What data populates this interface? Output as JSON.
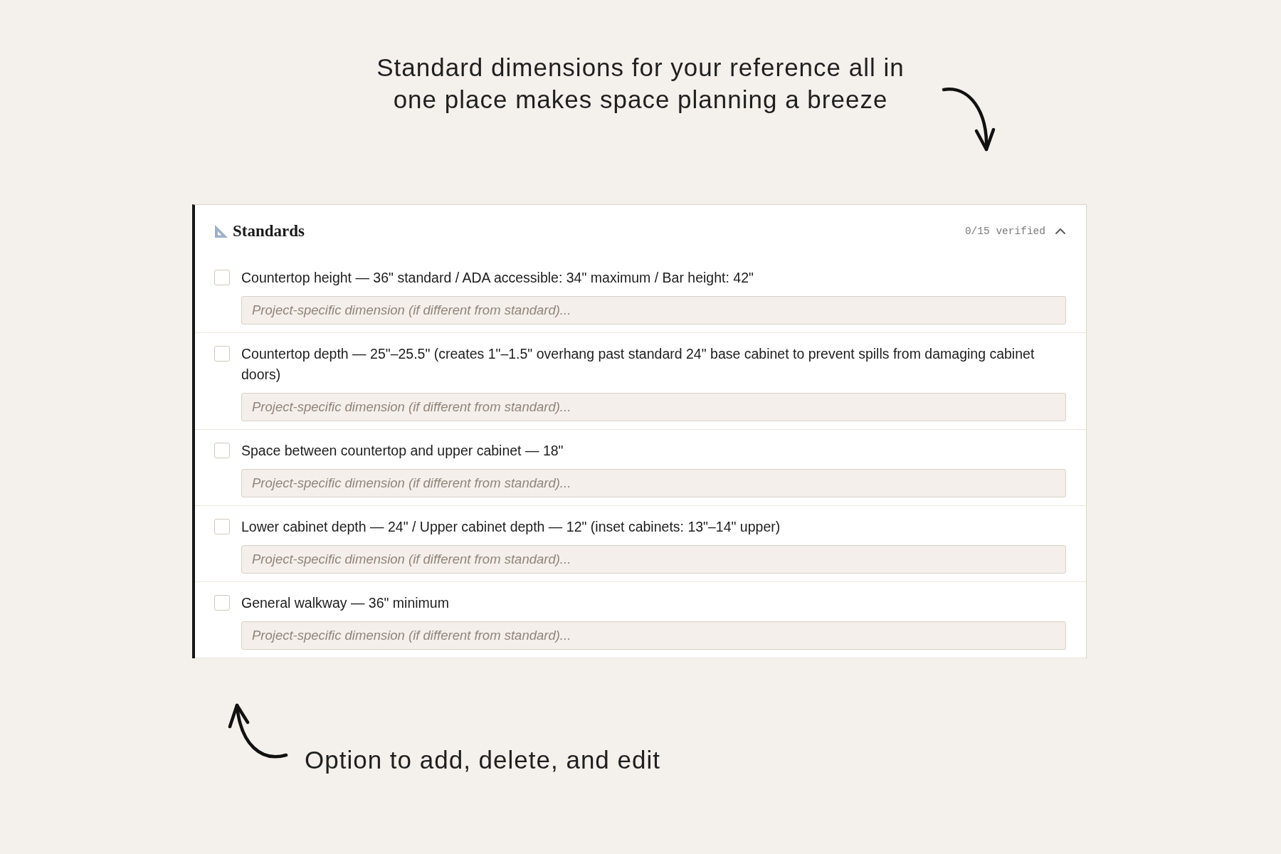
{
  "annotations": {
    "top": {
      "text": "Standard dimensions for your reference all in one place makes space planning a breeze"
    },
    "bottom": {
      "text": "Option to add, delete, and edit"
    }
  },
  "panel": {
    "title": "Standards",
    "progress": "0/15 verified",
    "expanded": true,
    "items": [
      {
        "label": "Countertop height — 36\" standard / ADA accessible: 34\" maximum / Bar height: 42\"",
        "checked": false,
        "placeholder": "Project-specific dimension (if different from standard)..."
      },
      {
        "label": "Countertop depth — 25\"–25.5\" (creates 1\"–1.5\" overhang past standard 24\" base cabinet to prevent spills from damaging cabinet doors)",
        "checked": false,
        "placeholder": "Project-specific dimension (if different from standard)..."
      },
      {
        "label": "Space between countertop and upper cabinet — 18\"",
        "checked": false,
        "placeholder": "Project-specific dimension (if different from standard)..."
      },
      {
        "label": "Lower cabinet depth — 24\" / Upper cabinet depth — 12\" (inset cabinets: 13\"–14\" upper)",
        "checked": false,
        "placeholder": "Project-specific dimension (if different from standard)..."
      },
      {
        "label": "General walkway — 36\" minimum",
        "checked": false,
        "placeholder": "Project-specific dimension (if different from standard)..."
      }
    ]
  }
}
